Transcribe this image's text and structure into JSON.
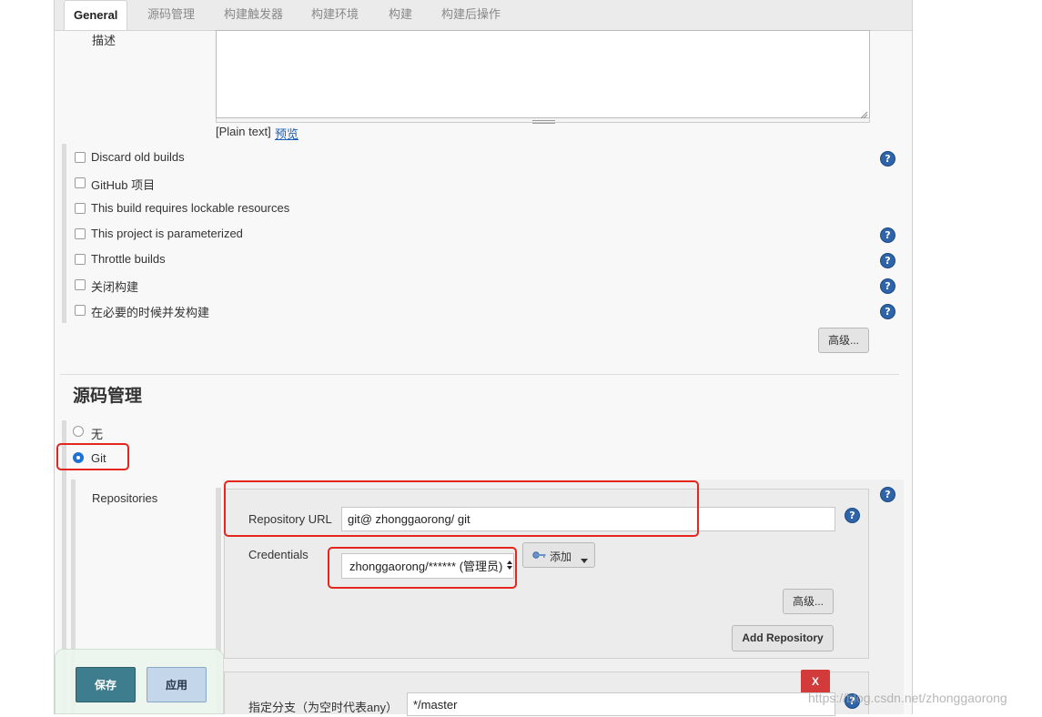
{
  "tabs": [
    {
      "label": "General"
    },
    {
      "label": "源码管理"
    },
    {
      "label": "构建触发器"
    },
    {
      "label": "构建环境"
    },
    {
      "label": "构建"
    },
    {
      "label": "构建后操作"
    }
  ],
  "general": {
    "description_label": "描述",
    "description_value": "",
    "plain_text": "[Plain text]",
    "preview_link": "预览",
    "options": [
      {
        "label": "Discard old builds",
        "checked": false
      },
      {
        "label": "GitHub 项目",
        "checked": false
      },
      {
        "label": "This build requires lockable resources",
        "checked": false
      },
      {
        "label": "This project is parameterized",
        "checked": false
      },
      {
        "label": "Throttle builds",
        "checked": false
      },
      {
        "label": "关闭构建",
        "checked": false
      },
      {
        "label": "在必要的时候并发构建",
        "checked": false
      }
    ],
    "advanced_button": "高级..."
  },
  "scm": {
    "title": "源码管理",
    "options": [
      {
        "label": "无",
        "selected": false
      },
      {
        "label": "Git",
        "selected": true
      }
    ],
    "repositories_label": "Repositories",
    "repository_url_label": "Repository URL",
    "repository_url_value": "git@          zhonggaorong/       git",
    "credentials_label": "Credentials",
    "credentials_value": "zhonggaorong/****** (管理员)",
    "add_button": "添加",
    "advanced_button": "高级...",
    "add_repository_button": "Add Repository",
    "delete_button": "X",
    "branch_label": "指定分支（为空时代表any）",
    "branch_value": "*/master"
  },
  "footer": {
    "save_button": "保存",
    "apply_button": "应用"
  },
  "watermark": "https://blog.csdn.net/zhonggaorong",
  "colors": {
    "accent": "#2f64a8",
    "highlight": "#e4261c",
    "save": "#3e7d8d",
    "delete": "#d33b3b"
  }
}
